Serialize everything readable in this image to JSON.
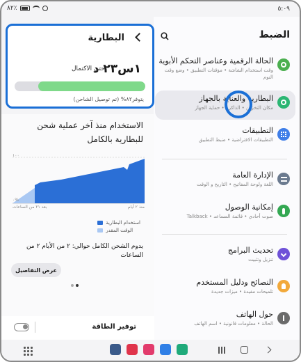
{
  "status_bar": {
    "time": "٥:٠٩",
    "battery": "٨٢٪"
  },
  "settings": {
    "title": "الضبط",
    "items": [
      {
        "title": "الحالة الرقمية وعناصر التحكم الأبوية",
        "subtitle": "وقت استخدام الشاشة • مؤقتات التطبيق • وضع وقت النوم",
        "icon": "digital-wellbeing-icon",
        "color": "#4caf50"
      },
      {
        "title": "البطارية والعناية بالجهاز",
        "subtitle": "مكان التخزين • الذاكرة • حماية الجهاز",
        "icon": "device-care-icon",
        "color": "#2bb673"
      },
      {
        "title": "التطبيقات",
        "subtitle": "التطبيقات الافتراضية • ضبط التطبيق",
        "icon": "apps-icon",
        "color": "#3f7ee8"
      },
      {
        "title": "الإدارة العامة",
        "subtitle": "اللغة ولوحة المفاتيح • التاريخ و الوقت",
        "icon": "general-management-icon",
        "color": "#6b7a8f"
      },
      {
        "title": "إمكانية الوصول",
        "subtitle": "صوت أحادي • قائمة المساعد • Talkback",
        "icon": "accessibility-icon",
        "color": "#34a853"
      },
      {
        "title": "تحديث البرامج",
        "subtitle": "تنزيل وتثبيت",
        "icon": "software-update-icon",
        "color": "#6f52d8"
      },
      {
        "title": "النصائح ودليل المستخدم",
        "subtitle": "تلميحات مفيدة • ميزات جديدة",
        "icon": "tips-icon",
        "color": "#f2a93b"
      },
      {
        "title": "حول الهاتف",
        "subtitle": "الحالة • معلومات قانونية • اسم الهاتف",
        "icon": "about-phone-icon",
        "color": "#6b6b6b"
      }
    ]
  },
  "battery": {
    "title": "البطارية",
    "time_left": "١س٢٣ د",
    "time_left_suffix": "حتى الاكتمال",
    "level_percent": 82,
    "status": "يتوفر٨٢% (تم توصيل الشاحن)",
    "bar_color": "#7fd98a"
  },
  "usage": {
    "title": "الاستخدام منذ آخر عملية شحن للبطارية بالكامل",
    "y_max_label": "١٠٠",
    "y_min_label": "٠%",
    "x_start_label": "منذ ٢ أيام",
    "x_end_label": "بعد ٢١ من الساعات",
    "legend_used": "استخدام البطارية",
    "legend_estimated": "الوقت المقدر",
    "used_color": "#2b6fd6",
    "estimated_color": "#a9c8f3",
    "full_charge_text": "يدوم الشحن الكامل حوالي: ٢ من الأيام ٢ من الساعات",
    "details_button": "عرض التفاصيل"
  },
  "power_saving": {
    "label": "توفير الطاقة"
  },
  "dock_apps": [
    {
      "name": "settings-app",
      "color": "#3a5a8a"
    },
    {
      "name": "screen-recorder-app",
      "color": "#e0344b"
    },
    {
      "name": "flower-app",
      "color": "#e23b6c"
    },
    {
      "name": "messages-app",
      "color": "#2f7fe6"
    },
    {
      "name": "phone-app",
      "color": "#1faa7a"
    }
  ]
}
